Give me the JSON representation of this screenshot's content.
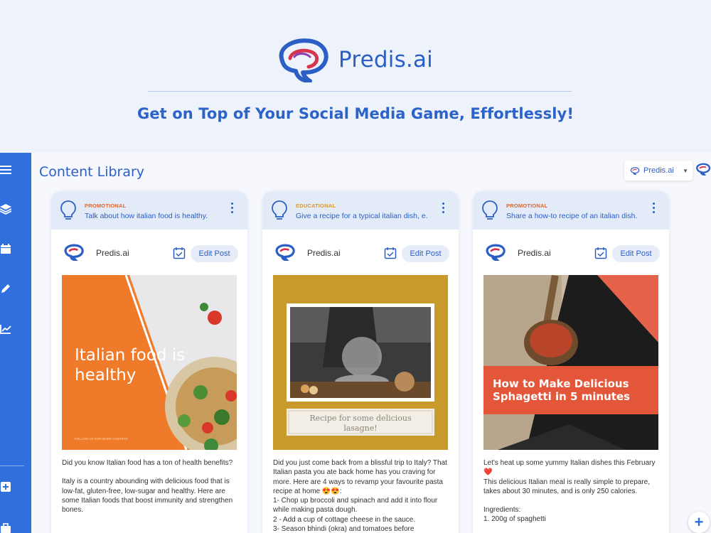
{
  "brand": {
    "name": "Predis.ai",
    "tagline": "Get on Top of Your Social Media Game, Effortlessly!"
  },
  "app": {
    "section_title": "Content Library",
    "account": {
      "name": "Predis.ai"
    }
  },
  "sidebar": {
    "icons": [
      "menu-icon",
      "layers-icon",
      "calendar-icon",
      "pencil-icon",
      "analytics-icon",
      "add-icon",
      "briefcase-icon"
    ]
  },
  "cards": [
    {
      "type": "PROMOTIONAL",
      "type_color": "#e0662a",
      "topic": "Talk about how italian food is healthy.",
      "handle": "Predis.ai",
      "edit_label": "Edit Post",
      "image_text": [
        "Italian food is",
        "healthy"
      ],
      "image_small_text": "FOLLOW US FOR MORE CONTENT",
      "caption": [
        "Did you know Italian food has a ton of health benefits?",
        "Italy is a country abounding with delicious food that is low-fat, gluten-free, low-sugar and healthy. Here are some Italian foods that boost immunity and strengthen bones."
      ]
    },
    {
      "type": "EDUCATIONAL",
      "type_color": "#e09a1a",
      "topic": "Give a recipe for a typical italian dish, e.",
      "handle": "Predis.ai",
      "edit_label": "Edit Post",
      "image_text": [
        "Recipe for some delicious",
        "lasagne!"
      ],
      "caption": [
        "Did you just come back from a blissful trip to Italy? That Italian pasta you ate back home has you craving for more. Here are 4 ways to revamp your favourite pasta recipe at home 😍😍:",
        "1- Chop up broccoli and spinach and add it into flour while making pasta dough.",
        "2 - Add a cup of cottage cheese in the sauce.",
        "3- Season bhindi (okra) and tomatoes before"
      ]
    },
    {
      "type": "PROMOTIONAL",
      "type_color": "#e0662a",
      "topic": "Share a how-to recipe of an italian dish.",
      "handle": "Predis.ai",
      "edit_label": "Edit Post",
      "image_text": [
        "How to Make Delicious",
        "Sphagetti in 5 minutes"
      ],
      "caption": [
        "Let's heat up some yummy Italian dishes this February ❤️",
        "This delicious Italian meal is really simple to prepare, takes about 30 minutes, and is only 250 calories.",
        "Ingredients:",
        "1. 200g of spaghetti"
      ]
    }
  ]
}
